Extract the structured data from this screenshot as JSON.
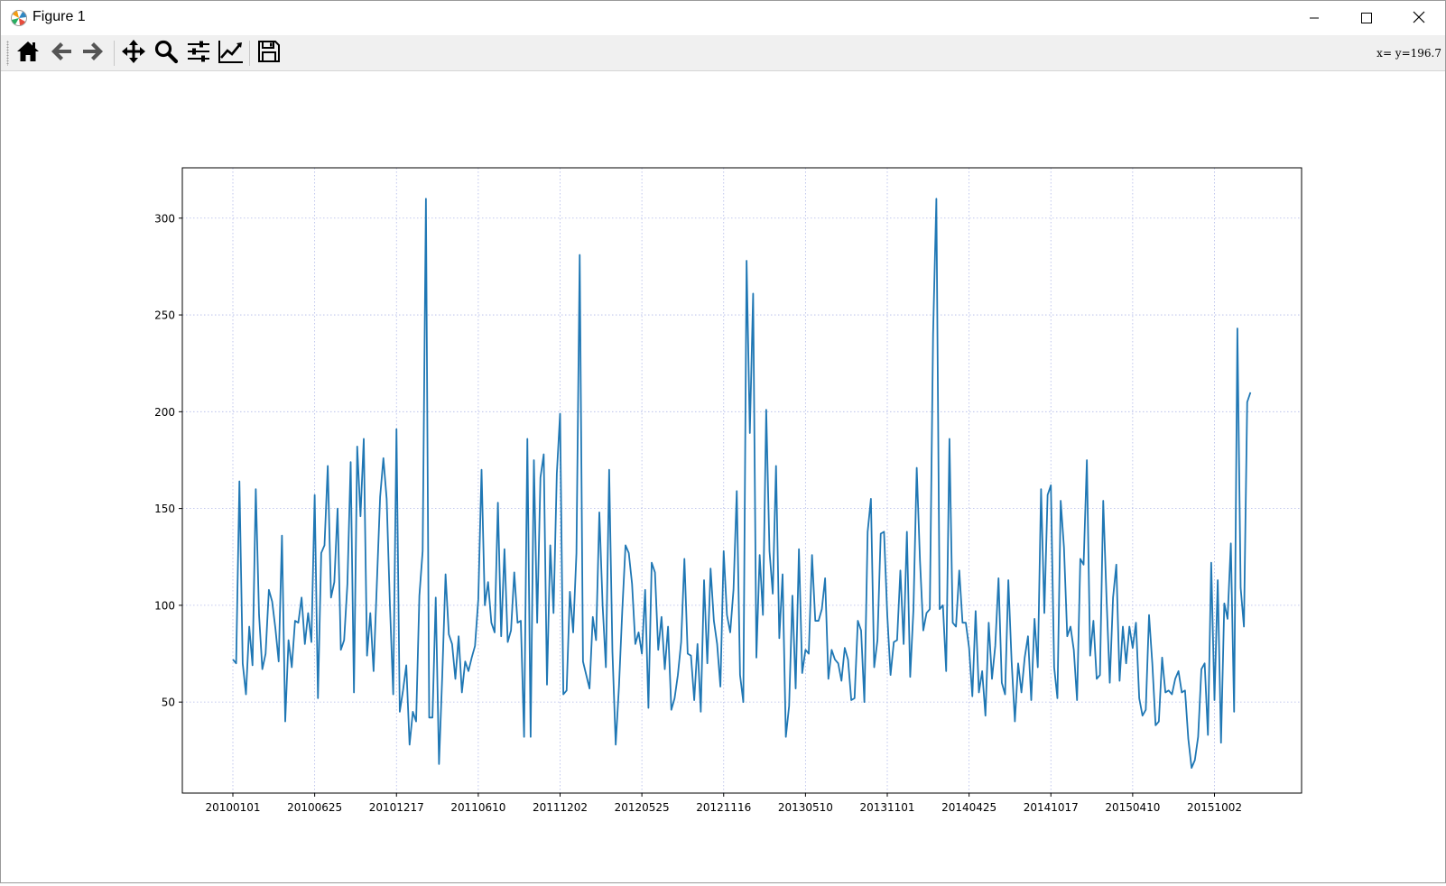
{
  "window": {
    "title": "Figure 1",
    "app_icon": "matplotlib-icon"
  },
  "window_controls": {
    "minimize_icon": "minimize-icon",
    "maximize_icon": "maximize-icon",
    "close_icon": "close-icon"
  },
  "toolbar": {
    "tools": [
      {
        "name": "home",
        "icon": "home-icon"
      },
      {
        "name": "back",
        "icon": "arrow-left-icon"
      },
      {
        "name": "forward",
        "icon": "arrow-right-icon"
      },
      {
        "name": "pan",
        "icon": "move-icon"
      },
      {
        "name": "zoom",
        "icon": "magnifier-icon"
      },
      {
        "name": "subplots",
        "icon": "sliders-icon"
      },
      {
        "name": "edit-axes",
        "icon": "line-chart-icon"
      },
      {
        "name": "save",
        "icon": "floppy-disk-icon"
      }
    ],
    "coordinates": "x= y=196.7"
  },
  "chart_data": {
    "type": "line",
    "title": "",
    "xlabel": "",
    "ylabel": "",
    "grid": true,
    "line_color": "#1f77b4",
    "grid_color": "#b0b8e8",
    "ylim": [
      3,
      326
    ],
    "yticks": [
      50,
      100,
      150,
      200,
      250,
      300
    ],
    "xtick_labels": [
      "20100101",
      "20100625",
      "20101217",
      "20110610",
      "20111202",
      "20120525",
      "20121116",
      "20130510",
      "20131101",
      "20140425",
      "20141017",
      "20150410",
      "20151002"
    ],
    "xtick_step": 25,
    "x_count": 312,
    "x_first": "20100101",
    "x_interval_days": 7,
    "values": [
      72,
      70,
      164,
      70,
      54,
      89,
      69,
      160,
      95,
      67,
      75,
      108,
      102,
      88,
      71,
      136,
      40,
      82,
      68,
      92,
      91,
      104,
      80,
      96,
      81,
      157,
      52,
      127,
      131,
      172,
      104,
      112,
      150,
      77,
      82,
      111,
      174,
      55,
      182,
      146,
      186,
      74,
      96,
      66,
      111,
      156,
      176,
      155,
      100,
      54,
      191,
      45,
      56,
      69,
      28,
      45,
      40,
      105,
      128,
      310,
      42,
      42,
      104,
      18,
      64,
      116,
      85,
      80,
      62,
      84,
      55,
      71,
      66,
      73,
      79,
      103,
      170,
      100,
      112,
      91,
      86,
      153,
      84,
      129,
      81,
      87,
      117,
      91,
      92,
      32,
      186,
      32,
      175,
      91,
      166,
      178,
      59,
      131,
      96,
      168,
      199,
      54,
      56,
      107,
      86,
      127,
      281,
      71,
      64,
      57,
      94,
      82,
      148,
      100,
      68,
      170,
      76,
      28,
      58,
      97,
      131,
      127,
      111,
      80,
      86,
      75,
      108,
      47,
      122,
      117,
      77,
      94,
      67,
      89,
      46,
      52,
      64,
      81,
      124,
      75,
      74,
      51,
      80,
      45,
      113,
      70,
      119,
      92,
      80,
      58,
      128,
      95,
      86,
      108,
      159,
      64,
      50,
      278,
      189,
      261,
      73,
      126,
      95,
      201,
      128,
      106,
      172,
      83,
      116,
      32,
      48,
      105,
      57,
      129,
      65,
      77,
      75,
      126,
      92,
      92,
      98,
      114,
      62,
      77,
      72,
      70,
      61,
      78,
      72,
      51,
      52,
      92,
      87,
      50,
      138,
      155,
      68,
      82,
      137,
      138,
      95,
      64,
      81,
      82,
      118,
      80,
      138,
      63,
      98,
      171,
      123,
      87,
      96,
      98,
      240,
      310,
      98,
      100,
      66,
      186,
      91,
      89,
      118,
      91,
      91,
      78,
      53,
      97,
      55,
      66,
      43,
      91,
      62,
      79,
      114,
      60,
      54,
      113,
      71,
      40,
      70,
      55,
      73,
      84,
      51,
      93,
      68,
      160,
      96,
      157,
      162,
      68,
      52,
      154,
      130,
      84,
      89,
      77,
      51,
      124,
      121,
      175,
      74,
      92,
      62,
      64,
      154,
      104,
      60,
      104,
      121,
      61,
      89,
      70,
      89,
      78,
      91,
      52,
      43,
      46,
      95,
      70,
      38,
      40,
      73,
      55,
      56,
      54,
      62,
      66,
      55,
      56,
      31,
      16,
      20,
      32,
      67,
      70,
      33,
      122,
      51,
      113,
      29,
      101,
      93,
      132,
      45,
      243,
      109,
      89,
      205,
      210
    ]
  }
}
